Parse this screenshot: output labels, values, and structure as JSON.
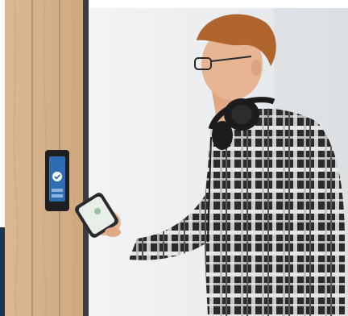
{
  "scene": {
    "subject": "man-with-smartphone-at-access-reader",
    "colors": {
      "wood": "#d6b58f",
      "wood_dark": "#b8926a",
      "glass": "#eef0f1",
      "door_frame": "#3b3d40",
      "navy_panel": "#1b3556",
      "reader_body": "#1f1f22",
      "reader_screen": "#2f6db3",
      "reader_check": "#ffffff",
      "shirt_dark": "#2a2a2d",
      "shirt_light": "#e6e6e6",
      "skin": "#e8b594",
      "hair": "#b0652f",
      "headphones": "#1c1c1e",
      "phone_body": "#2b2b2e",
      "phone_screen": "#e7efe8"
    },
    "icons": {
      "reader_status": "check-icon",
      "headphones": "headphones-icon"
    }
  }
}
